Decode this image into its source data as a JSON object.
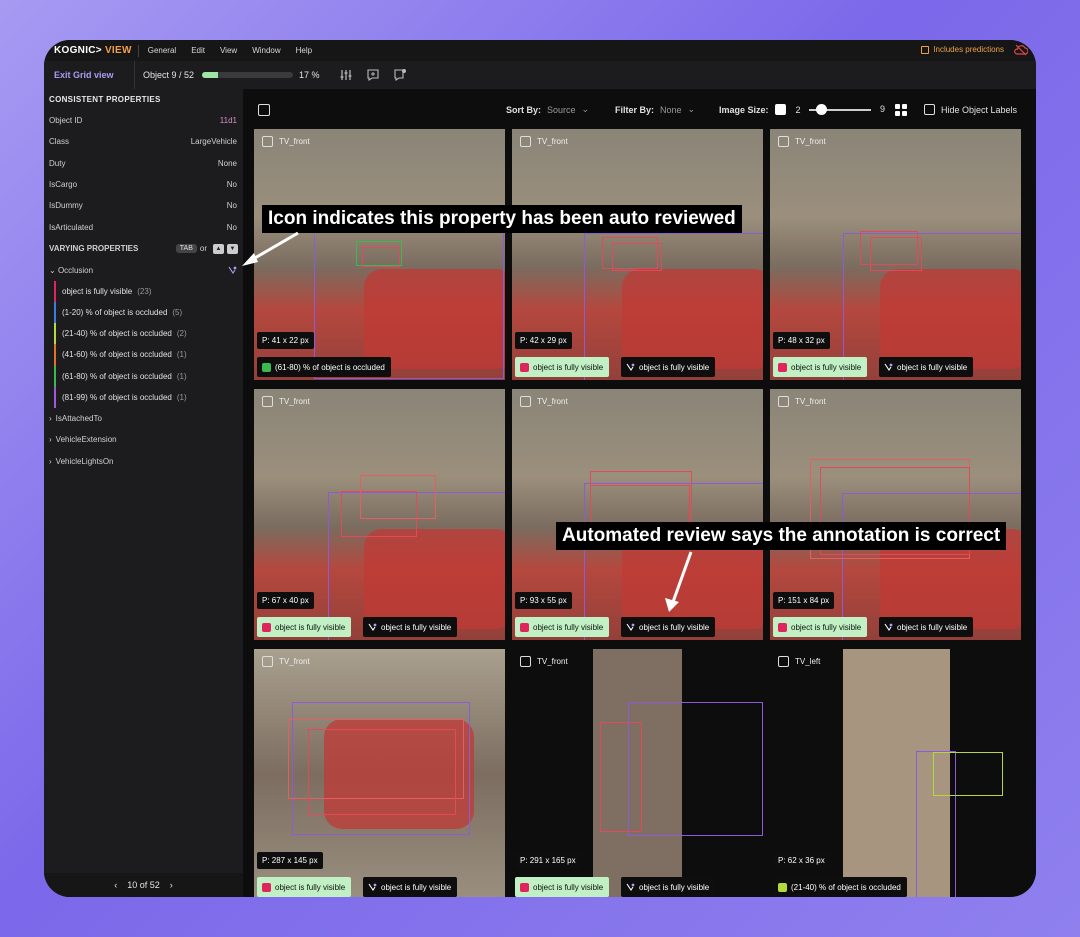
{
  "menubar": {
    "logo": "KOGNIC>",
    "logo_suffix": "VIEW",
    "items": [
      "General",
      "Edit",
      "View",
      "Window",
      "Help"
    ],
    "predictions": "Includes predictions"
  },
  "toolbar": {
    "exit": "Exit Grid view",
    "object": "Object 9 / 52",
    "progress_pct": 17,
    "progress_label": "17 %"
  },
  "sidebar": {
    "consistent_title": "CONSISTENT PROPERTIES",
    "props": [
      {
        "k": "Object ID",
        "v": "11d1"
      },
      {
        "k": "Class",
        "v": "LargeVehicle"
      },
      {
        "k": "Duty",
        "v": "None"
      },
      {
        "k": "IsCargo",
        "v": "No"
      },
      {
        "k": "IsDummy",
        "v": "No"
      },
      {
        "k": "IsArticulated",
        "v": "No"
      }
    ],
    "varying_title": "VARYING PROPERTIES",
    "tab_key": "TAB",
    "or": "or",
    "occlusion": "Occlusion",
    "occl_items": [
      {
        "l": "object is fully visible",
        "c": "(23)",
        "col": "#e0245e"
      },
      {
        "l": "(1-20) % of object is occluded",
        "c": "(5)",
        "col": "#3b7de0"
      },
      {
        "l": "(21-40) % of object is occluded",
        "c": "(2)",
        "col": "#b3d93a"
      },
      {
        "l": "(41-60) % of object is occluded",
        "c": "(1)",
        "col": "#e0702a"
      },
      {
        "l": "(61-80) % of object is occluded",
        "c": "(1)",
        "col": "#3cb94e"
      },
      {
        "l": "(81-99) % of object is occluded",
        "c": "(1)",
        "col": "#a05ad8"
      }
    ],
    "collapsed": [
      "IsAttachedTo",
      "VehicleExtension",
      "VehicleLightsOn"
    ],
    "pager": "10 of 52"
  },
  "filters": {
    "sort_by": "Sort By:",
    "sort_val": "Source",
    "filter_by": "Filter By:",
    "filter_val": "None",
    "image_size": "Image Size:",
    "min": "2",
    "max": "9",
    "hide": "Hide Object Labels"
  },
  "cells": [
    {
      "cam": "TV_front",
      "px": "P: 41 x 22 px",
      "tags": [
        {
          "t": "(61-80) % of object is occluded",
          "style": "d",
          "dot": "#3cb94e"
        }
      ]
    },
    {
      "cam": "TV_front",
      "px": "P: 42 x 29 px",
      "tags": [
        {
          "t": "object is fully visible",
          "style": "l",
          "dot": "#e0245e"
        },
        {
          "t": "object is fully visible",
          "style": "d",
          "icon": true
        }
      ]
    },
    {
      "cam": "TV_front",
      "px": "P: 48 x 32 px",
      "tags": [
        {
          "t": "object is fully visible",
          "style": "l",
          "dot": "#e0245e"
        },
        {
          "t": "object is fully visible",
          "style": "d",
          "icon": true
        }
      ]
    },
    {
      "cam": "TV_front",
      "px": "P: 67 x 40 px",
      "tags": [
        {
          "t": "object is fully visible",
          "style": "l",
          "dot": "#e0245e"
        },
        {
          "t": "object is fully visible",
          "style": "d",
          "icon": true
        }
      ]
    },
    {
      "cam": "TV_front",
      "px": "P: 93 x 55 px",
      "tags": [
        {
          "t": "object is fully visible",
          "style": "l",
          "dot": "#e0245e"
        },
        {
          "t": "object is fully visible",
          "style": "d",
          "icon": true
        }
      ]
    },
    {
      "cam": "TV_front",
      "px": "P: 151 x 84 px",
      "tags": [
        {
          "t": "object is fully visible",
          "style": "l",
          "dot": "#e0245e"
        },
        {
          "t": "object is fully visible",
          "style": "d",
          "icon": true
        }
      ]
    },
    {
      "cam": "TV_front",
      "px": "P: 287 x 145 px",
      "tags": [
        {
          "t": "object is fully visible",
          "style": "l",
          "dot": "#e0245e"
        },
        {
          "t": "object is fully visible",
          "style": "d",
          "icon": true
        }
      ]
    },
    {
      "cam": "TV_front",
      "px": "P: 291 x 165 px",
      "tags": [
        {
          "t": "object is fully visible",
          "style": "l",
          "dot": "#e0245e"
        },
        {
          "t": "object is fully visible",
          "style": "d",
          "icon": true
        }
      ]
    },
    {
      "cam": "TV_left",
      "px": "P: 62 x 36 px",
      "tags": [
        {
          "t": "(21-40) % of object is occluded",
          "style": "d",
          "dot": "#b3d93a"
        }
      ]
    }
  ],
  "annotations": {
    "top": "Icon indicates this property has been auto reviewed",
    "mid": "Automated review says the annotation is correct"
  }
}
